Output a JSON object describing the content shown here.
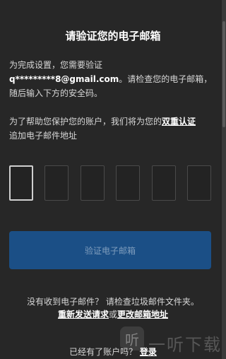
{
  "title": "请验证您的电子邮箱",
  "intro": {
    "prefix": "为完成设置，您需要验证",
    "email": "q*********8@gmail.com",
    "suffix": "。请检查您的电子邮箱，随后输入下方的安全码。"
  },
  "protect": {
    "text": "为了帮助您保护您的账户，我们将为您的",
    "link": "双重认证",
    "suffix": "追加电子邮件地址"
  },
  "code_boxes": [
    "",
    "",
    "",
    "",
    "",
    ""
  ],
  "verify_button": "验证电子邮箱",
  "no_receive": "没有收到电子邮件？ 请检查垃圾邮件文件夹。",
  "resend_link": "重新发送请求",
  "or_text": "或",
  "change_link": "更改邮箱地址",
  "footer": {
    "text": "已经有了账户吗？",
    "login": "登录"
  },
  "watermark": {
    "icon_char": "听",
    "text": "一听下载"
  },
  "colors": {
    "background": "#272727",
    "button": "#1b4f86"
  }
}
